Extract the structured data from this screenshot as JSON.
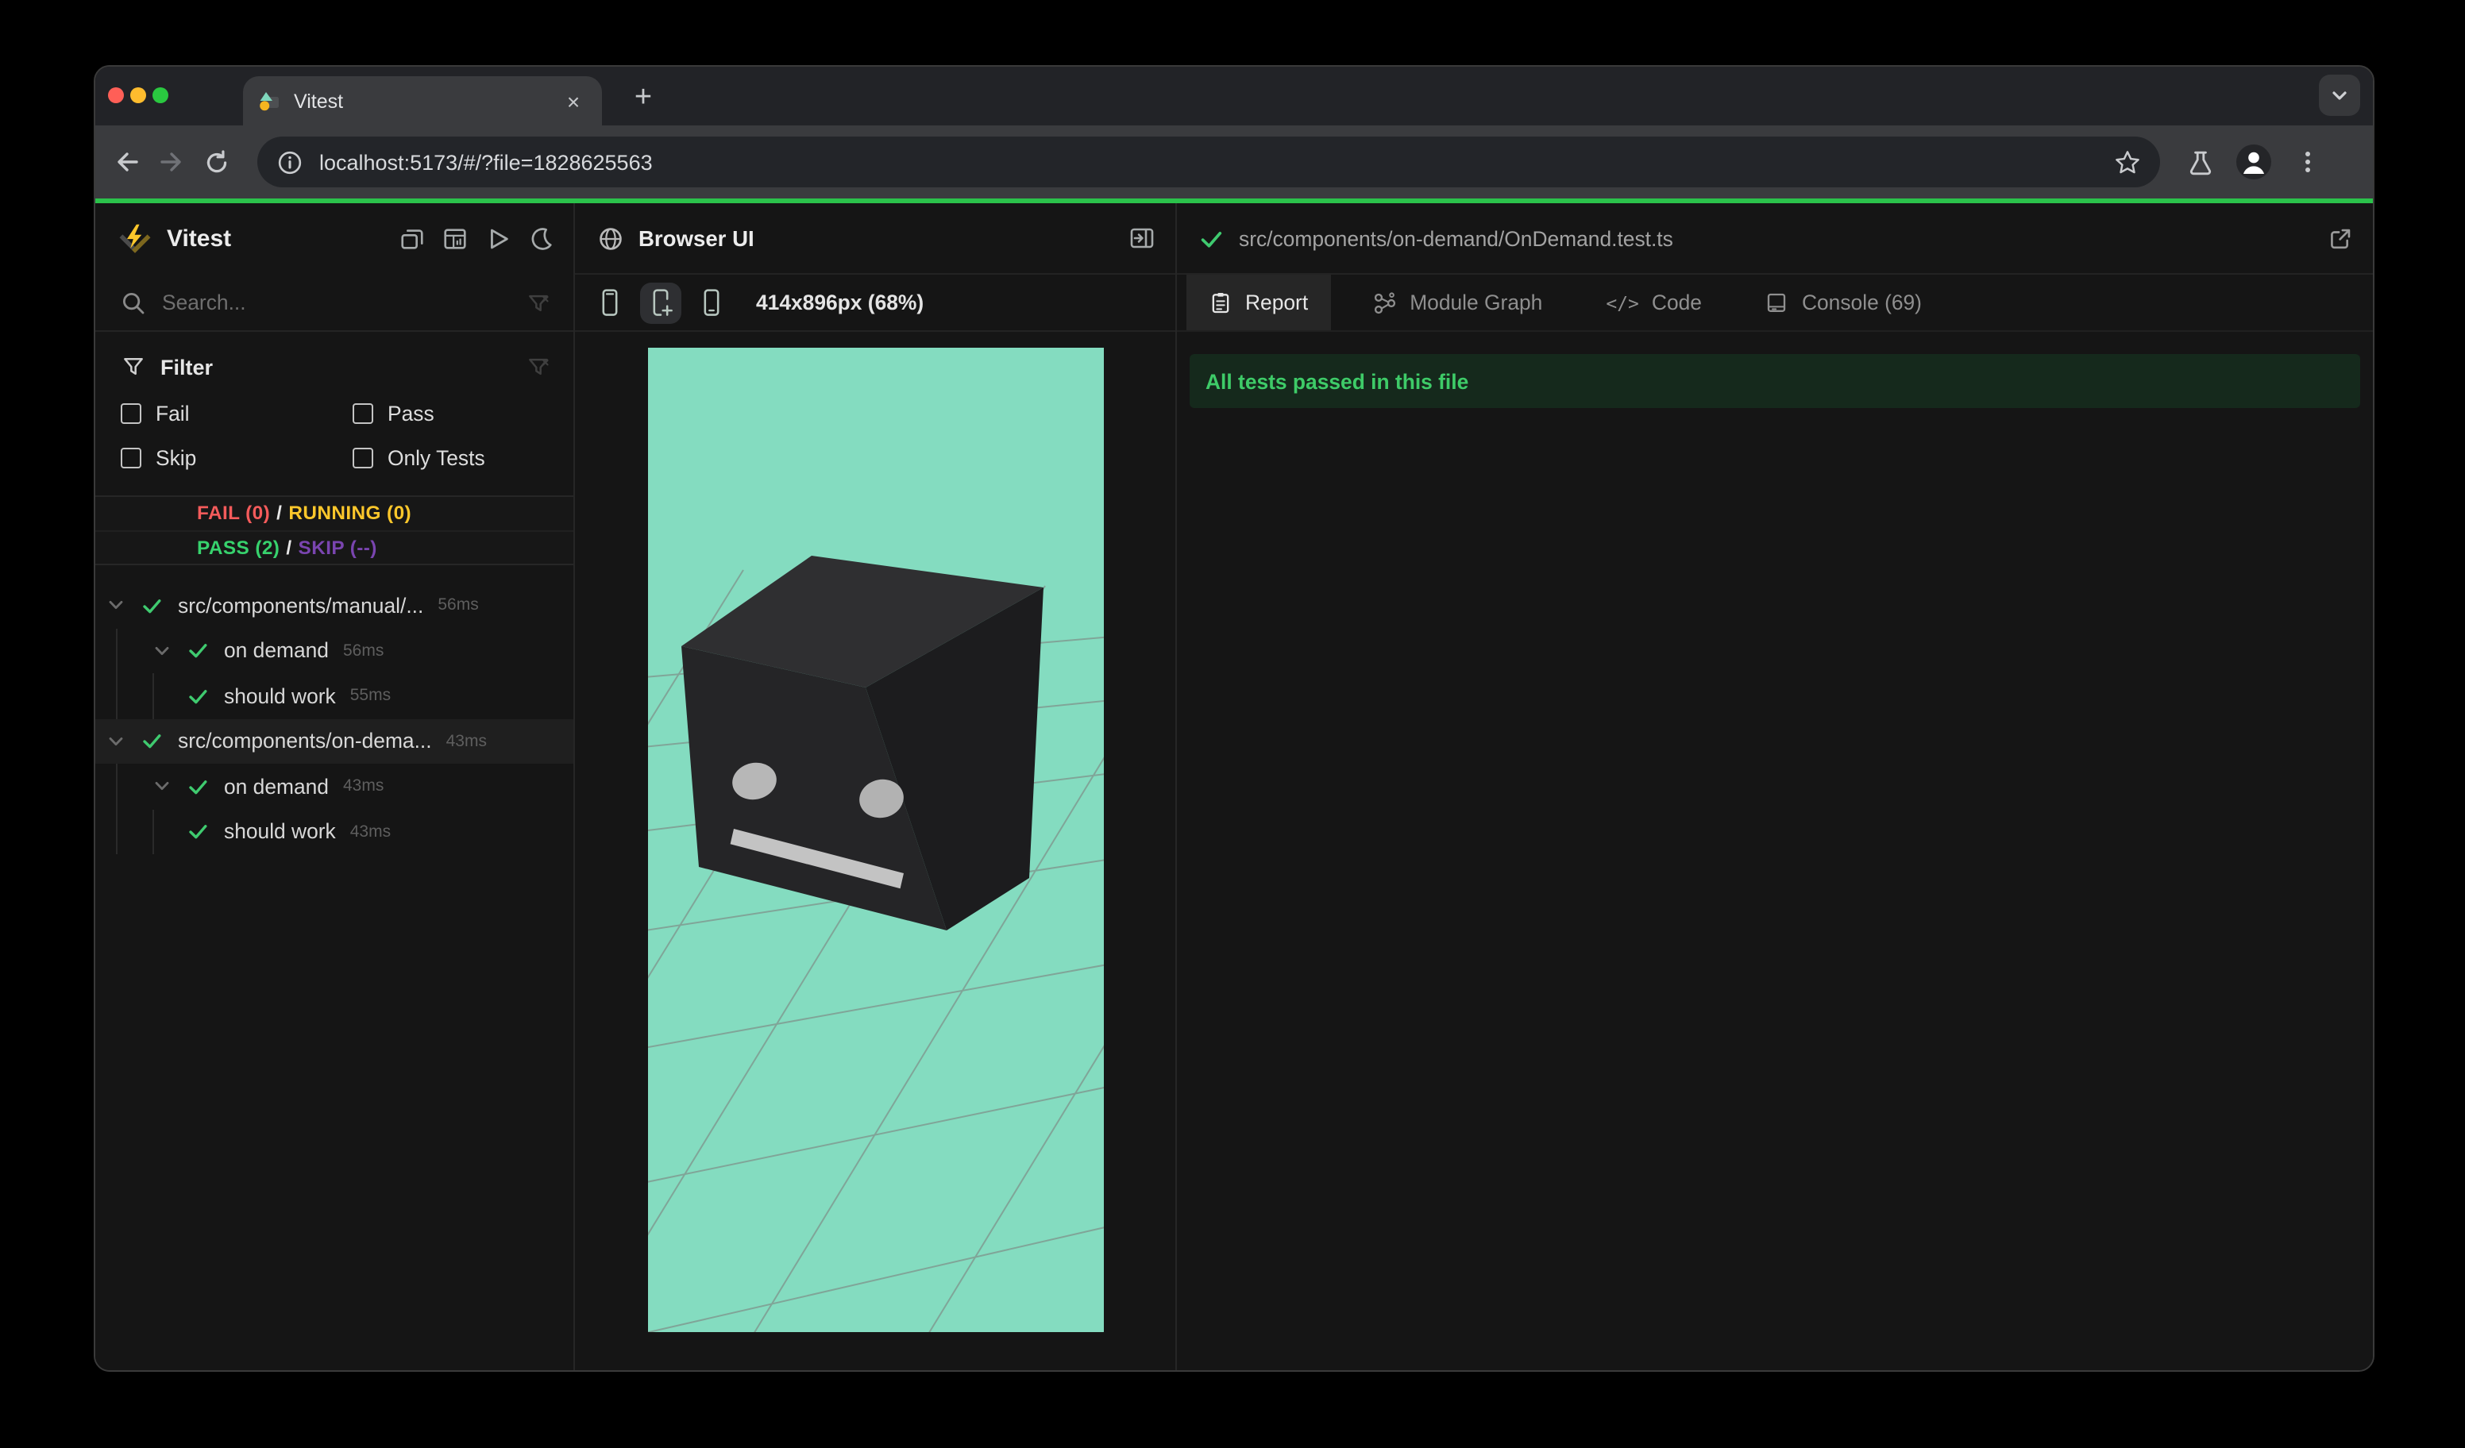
{
  "browser": {
    "tab_title": "Vitest",
    "url": "localhost:5173/#/?file=1828625563",
    "close_tab_glyph": "×",
    "new_tab_glyph": "+"
  },
  "colors": {
    "traffic_red": "#ff5f57",
    "traffic_yellow": "#febc2e",
    "traffic_green": "#2ac840",
    "progress_green": "#2bc24b",
    "brand_yellow": "#fcc72b",
    "pass_green": "#3fca6f",
    "fail_red": "#f45b5b",
    "running_yellow": "#fcc72b",
    "skip_purple": "#7a45b0",
    "banner_bg": "#15291c",
    "banner_text": "#3ecb68",
    "preview_bg": "#84dcc0"
  },
  "sidebar": {
    "title": "Vitest",
    "search_placeholder": "Search...",
    "filter": {
      "title": "Filter",
      "options": [
        {
          "label": "Fail",
          "checked": false
        },
        {
          "label": "Pass",
          "checked": false
        },
        {
          "label": "Skip",
          "checked": false
        },
        {
          "label": "Only Tests",
          "checked": false
        }
      ]
    },
    "stats": {
      "fail": "FAIL (0)",
      "running": "RUNNING (0)",
      "pass": "PASS (2)",
      "skip": "SKIP (--)",
      "separator": "/"
    },
    "tree": [
      {
        "label": "src/components/manual/...",
        "time": "56ms",
        "level": 0,
        "status": "pass"
      },
      {
        "label": "on demand",
        "time": "56ms",
        "level": 1,
        "status": "pass"
      },
      {
        "label": "should work",
        "time": "55ms",
        "level": 2,
        "status": "pass"
      },
      {
        "label": "src/components/on-dema...",
        "time": "43ms",
        "level": 0,
        "status": "pass",
        "selected": true
      },
      {
        "label": "on demand",
        "time": "43ms",
        "level": 1,
        "status": "pass"
      },
      {
        "label": "should work",
        "time": "43ms",
        "level": 2,
        "status": "pass"
      }
    ]
  },
  "browser_ui": {
    "title": "Browser UI",
    "viewport": "414x896px (68%)"
  },
  "report": {
    "file_path": "src/components/on-demand/OnDemand.test.ts",
    "tabs": [
      {
        "label": "Report",
        "active": true
      },
      {
        "label": "Module Graph",
        "active": false
      },
      {
        "label": "Code",
        "active": false
      },
      {
        "label": "Console (69)",
        "active": false
      }
    ],
    "banner": "All tests passed in this file"
  },
  "icons": {
    "favicon": "vitest-logo",
    "browser_toolbar": [
      "back-arrow",
      "forward-arrow",
      "reload",
      "info-circle",
      "star",
      "flask",
      "profile-avatar",
      "kebab-menu"
    ],
    "sidebar_header": [
      "collapse-panels",
      "dashboard",
      "run-all-play",
      "dark-mode-moon"
    ],
    "sidebar_rows": [
      "search-magnifier",
      "filter-funnel",
      "clear-filter-funnel-x",
      "checkbox",
      "chevron-down",
      "check-pass"
    ],
    "browser_ui_panel": [
      "globe",
      "dock-panel-right",
      "device-phone",
      "device-phone-add",
      "device-phone-home"
    ],
    "report_panel": [
      "check-pass",
      "external-link",
      "clipboard-report",
      "module-graph-nodes",
      "code-brackets",
      "console-box"
    ]
  }
}
